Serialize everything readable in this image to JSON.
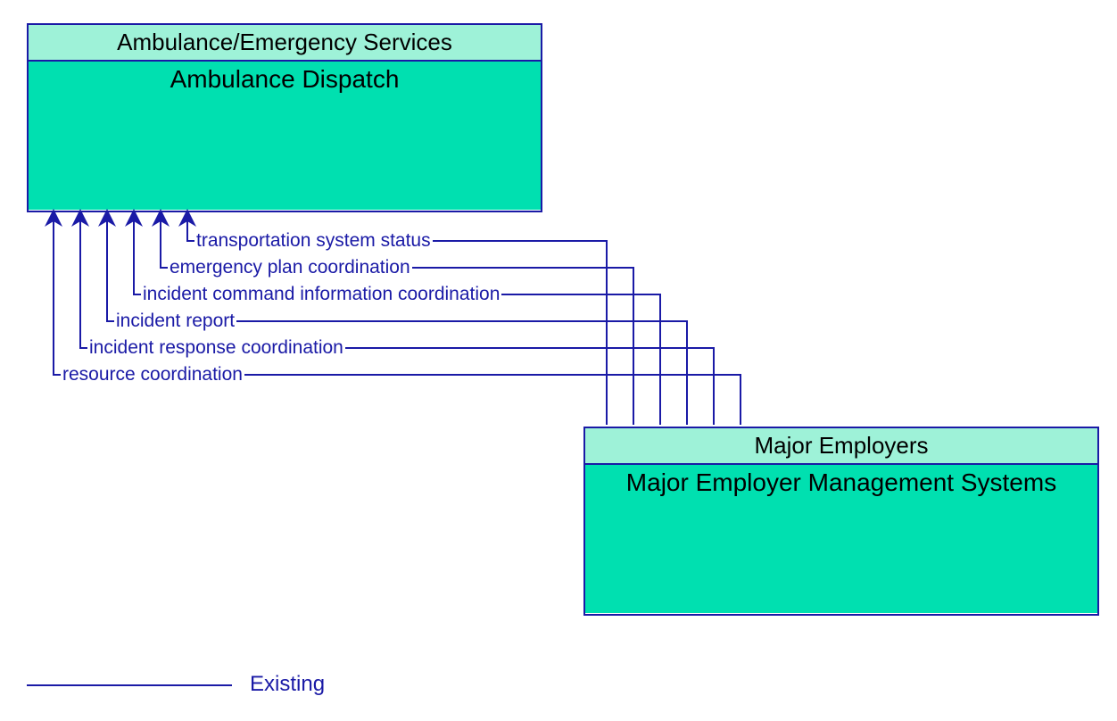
{
  "nodes": {
    "top": {
      "header": "Ambulance/Emergency Services",
      "body": "Ambulance Dispatch"
    },
    "bottom": {
      "header": "Major Employers",
      "body": "Major Employer Management Systems"
    }
  },
  "flows": [
    "transportation system status",
    "emergency plan coordination",
    "incident command information coordination",
    "incident report",
    "incident response coordination",
    "resource coordination"
  ],
  "legend": {
    "label": "Existing"
  },
  "colors": {
    "stroke": "#1a1aa6",
    "header_bg": "#9ef2d8",
    "body_bg": "#00e0b0"
  }
}
